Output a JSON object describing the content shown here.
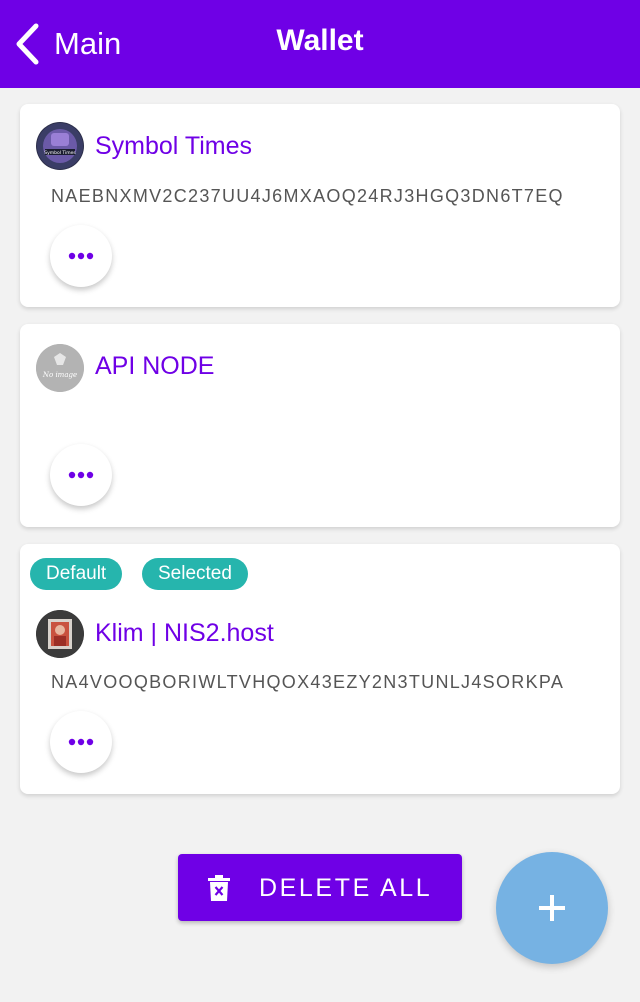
{
  "header": {
    "back_label": "Main",
    "title": "Wallet"
  },
  "accounts": [
    {
      "name": "Symbol Times",
      "address": "NAEBNXMV2C237UU4J6MXAOQ24RJ3HGQ3DN6T7EQ",
      "avatar_icon": "symbol-times-logo-icon",
      "badges": []
    },
    {
      "name": "API NODE",
      "address": "",
      "avatar_icon": "no-image-icon",
      "avatar_text": "No image",
      "badges": []
    },
    {
      "name": "Klim | NIS2.host",
      "address": "NA4VOOQBORIWLTVHQOX43EZY2N3TUNLJ4SORKPA",
      "avatar_icon": "klim-photo-icon",
      "badges": [
        "Default",
        "Selected"
      ]
    }
  ],
  "footer": {
    "delete_all_label": "DELETE ALL",
    "add_icon": "plus-icon"
  },
  "colors": {
    "primary": "#6f00e6",
    "badge": "#26b5ad",
    "fab": "#76b2e3",
    "background": "#f2f2f2"
  }
}
